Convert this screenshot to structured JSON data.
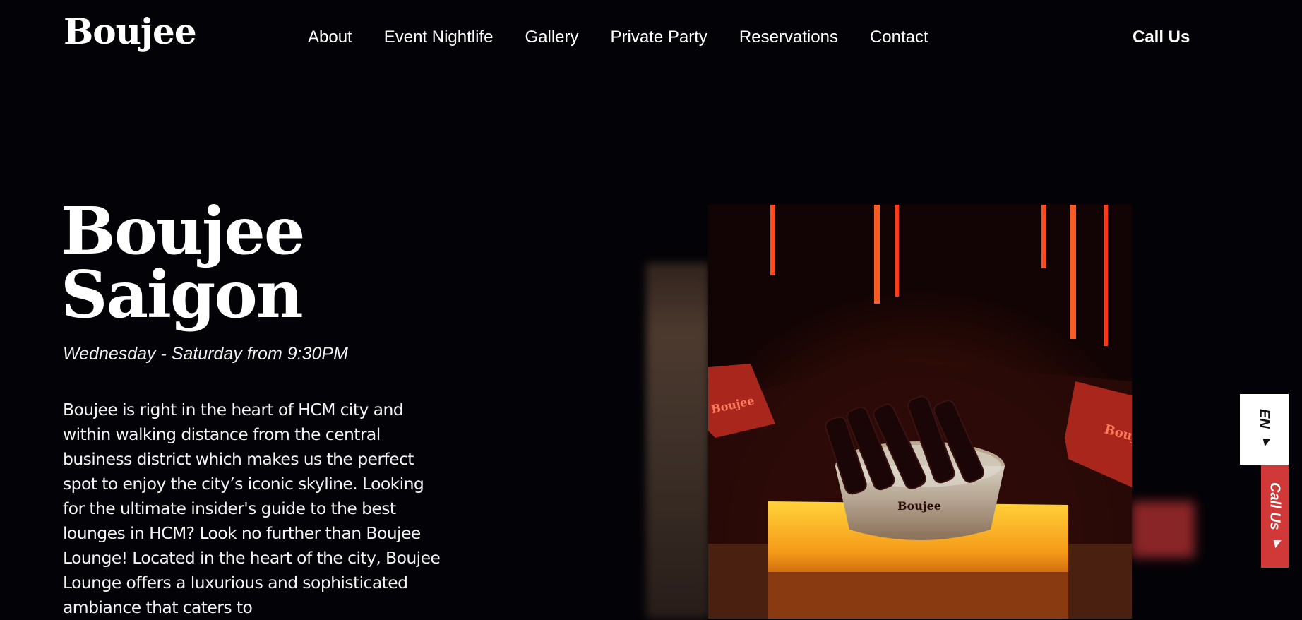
{
  "header": {
    "logo": "Boujee",
    "nav": [
      "About",
      "Event Nightlife",
      "Gallery",
      "Private Party",
      "Reservations",
      "Contact"
    ],
    "call_us": "Call Us"
  },
  "hero": {
    "title_line1": "Boujee",
    "title_line2": "Saigon",
    "hours": "Wednesday - Saturday from 9:30PM",
    "description": "Boujee is right in the heart of HCM city and within walking distance from the central business district which makes us the perfect spot to enjoy the city’s iconic skyline. Looking for the ultimate insider's guide to the best lounges in HCM? Look no further than Boujee Lounge! Located in the heart of the city, Boujee Lounge offers a luxurious and sophisticated ambiance that caters to",
    "photo": {
      "cushion_left": "Boujee",
      "cushion_right": "Bouj",
      "bucket": "Boujee"
    }
  },
  "side_widget": {
    "language": "EN ▾",
    "call": "Call Us ▾"
  },
  "colors": {
    "background": "#030206",
    "accent_red": "#d13838",
    "text": "#ffffff"
  }
}
